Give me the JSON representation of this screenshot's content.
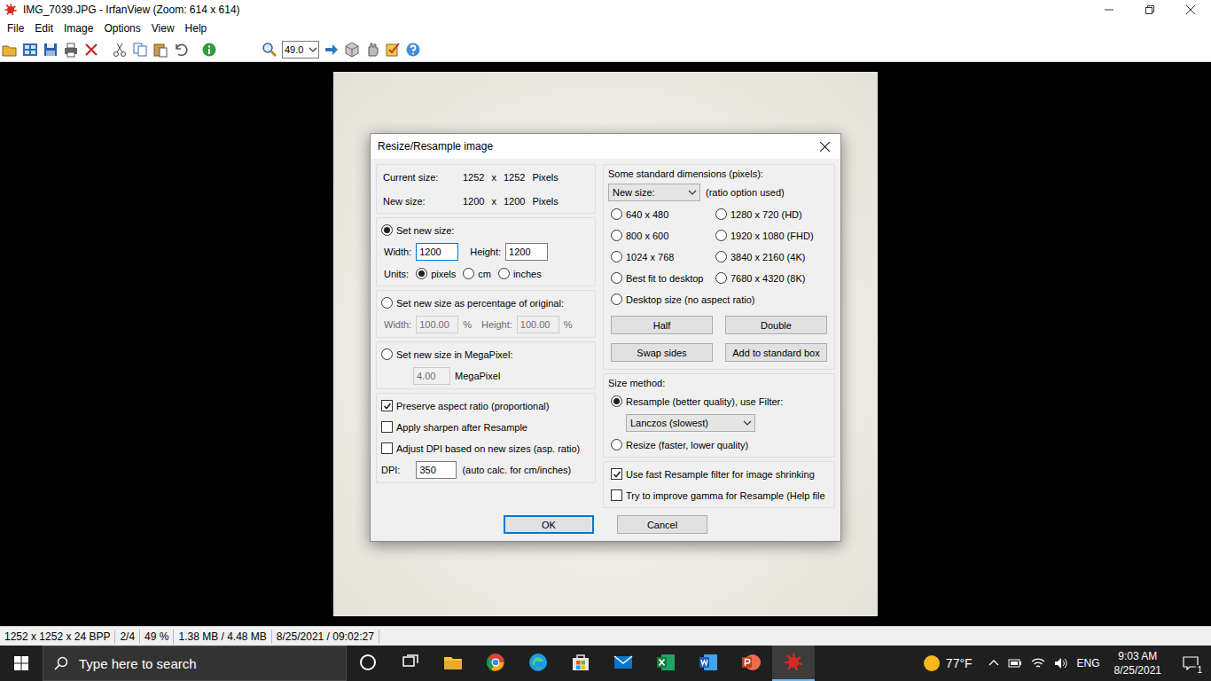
{
  "window": {
    "title": "IMG_7039.JPG - IrfanView (Zoom: 614 x 614)"
  },
  "menu": [
    "File",
    "Edit",
    "Image",
    "Options",
    "View",
    "Help"
  ],
  "toolbar": {
    "zoom": "49.0"
  },
  "dialog": {
    "title": "Resize/Resample image",
    "sizes": [
      {
        "label": "Current size:",
        "width": "1252",
        "x": "x",
        "height": "1252",
        "unit": "Pixels"
      },
      {
        "label": "New size:",
        "width": "1200",
        "x": "x",
        "height": "1200",
        "unit": "Pixels"
      }
    ],
    "set_new_size": {
      "label": "Set new size:",
      "selected": true,
      "width_label": "Width:",
      "width": "1200",
      "height_label": "Height:",
      "height": "1200",
      "units_label": "Units:",
      "units": [
        {
          "label": "pixels",
          "selected": true
        },
        {
          "label": "cm",
          "selected": false
        },
        {
          "label": "inches",
          "selected": false
        }
      ]
    },
    "percentage": {
      "label": "Set new size as percentage of original:",
      "selected": false,
      "disabled": true,
      "width_label": "Width:",
      "width": "100.00",
      "height_label": "Height:",
      "height": "100.00",
      "unit": "%"
    },
    "megapixel": {
      "label": "Set new size in MegaPixel:",
      "selected": false,
      "disabled": true,
      "value": "4.00",
      "unit": "MegaPixel"
    },
    "options": [
      {
        "label": "Preserve aspect ratio (proportional)",
        "checked": true
      },
      {
        "label": "Apply sharpen after Resample",
        "checked": false
      },
      {
        "label": "Adjust DPI based on new sizes (asp. ratio)",
        "checked": false
      }
    ],
    "dpi": {
      "label": "DPI:",
      "value": "350",
      "note": "(auto calc. for cm/inches)"
    },
    "standard": {
      "label": "Some standard dimensions (pixels):",
      "select": "New size:",
      "note": "(ratio option used)",
      "sizes": [
        {
          "label": "640 x 480",
          "selected": false
        },
        {
          "label": "1280 x 720  (HD)",
          "selected": false
        },
        {
          "label": "800 x 600",
          "selected": false
        },
        {
          "label": "1920 x 1080 (FHD)",
          "selected": false
        },
        {
          "label": "1024 x 768",
          "selected": false
        },
        {
          "label": "3840 x 2160 (4K)",
          "selected": false
        },
        {
          "label": "Best fit to desktop",
          "selected": false
        },
        {
          "label": "7680 x 4320 (8K)",
          "selected": false
        },
        {
          "label": "Desktop size (no aspect ratio)",
          "selected": false
        }
      ]
    },
    "buttons": [
      "Half",
      "Double",
      "Swap sides",
      "Add to standard box"
    ],
    "method": {
      "label": "Size method:",
      "resample": {
        "label": "Resample (better quality), use Filter:",
        "selected": true
      },
      "filter": "Lanczos (slowest)",
      "resize": {
        "label": "Resize (faster, lower quality)",
        "selected": false
      }
    },
    "method_options": [
      {
        "label": "Use fast Resample filter for image shrinking",
        "checked": true
      },
      {
        "label": "Try to improve gamma for Resample (Help file",
        "checked": false
      }
    ],
    "actions": [
      {
        "label": "OK",
        "default": true
      },
      {
        "label": "Cancel",
        "default": false
      }
    ]
  },
  "status_bar": [
    "1252 x 1252 x 24 BPP",
    "2/4",
    "49 %",
    "1.38 MB / 4.48 MB",
    "8/25/2021 / 09:02:27"
  ],
  "taskbar": {
    "search": "Type here to search",
    "apps": [
      {
        "kind": "cortana",
        "active": false
      },
      {
        "kind": "taskview",
        "active": false
      },
      {
        "kind": "explorer",
        "active": false
      },
      {
        "kind": "chrome",
        "active": false
      },
      {
        "kind": "edge",
        "active": false
      },
      {
        "kind": "store",
        "active": false
      },
      {
        "kind": "mail",
        "active": false
      },
      {
        "kind": "excel",
        "active": false
      },
      {
        "kind": "word",
        "active": false
      },
      {
        "kind": "powerpoint",
        "active": false
      },
      {
        "kind": "irfanview",
        "active": true
      }
    ],
    "weather": "77°F",
    "language": "ENG",
    "time": "9:03 AM",
    "date": "8/25/2021",
    "notifications": "1"
  }
}
